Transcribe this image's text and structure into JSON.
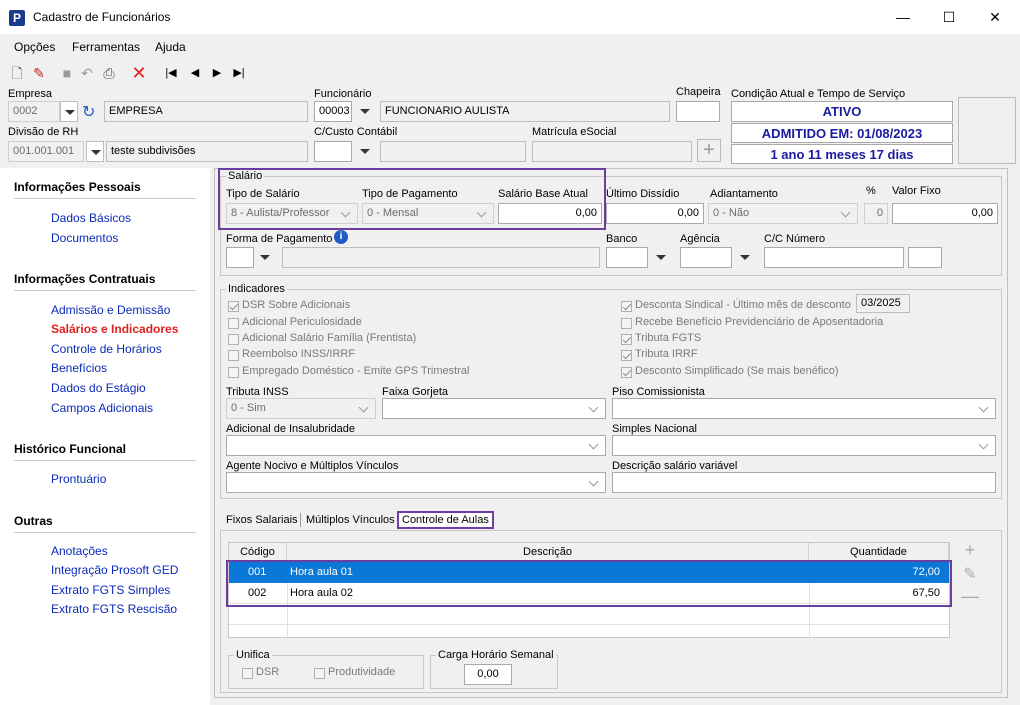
{
  "window": {
    "title": "Cadastro de Funcionários",
    "minimize": "—",
    "maximize": "☐",
    "close": "✕"
  },
  "menu": [
    "Opções",
    "Ferramentas",
    "Ajuda"
  ],
  "header": {
    "empresa_label": "Empresa",
    "empresa_code": "0002",
    "empresa_name": "EMPRESA",
    "funcionario_label": "Funcionário",
    "funcionario_code": "00003",
    "funcionario_name": "FUNCIONARIO AULISTA",
    "chapeira_label": "Chapeira",
    "condicao_label": "Condição Atual e Tempo de Serviço",
    "divisao_label": "Divisão de RH",
    "divisao_code": "001.001.001",
    "divisao_name": "teste subdivisões",
    "ccusto_label": "C/Custo Contábil",
    "matricula_label": "Matrícula eSocial",
    "status": "ATIVO",
    "admitido": "ADMITIDO EM: 01/08/2023",
    "tempo": "1 ano 11 meses 17 dias"
  },
  "sidebar": {
    "sections": [
      {
        "title": "Informações Pessoais",
        "items": [
          "Dados Básicos",
          "Documentos"
        ]
      },
      {
        "title": "Informações Contratuais",
        "items": [
          "Admissão e Demissão",
          "Salários e Indicadores",
          "Controle de Horários",
          "Benefícios",
          "Dados do Estágio",
          "Campos Adicionais"
        ]
      },
      {
        "title": "Histórico Funcional",
        "items": [
          "Prontuário"
        ]
      },
      {
        "title": "Outras",
        "items": [
          "Anotações",
          "Integração Prosoft GED",
          "Extrato FGTS Simples",
          "Extrato FGTS Rescisão"
        ]
      }
    ]
  },
  "salario": {
    "group_title": "Salário",
    "tipo_salario_label": "Tipo de Salário",
    "tipo_salario": "8 - Aulista/Professor",
    "tipo_pagamento_label": "Tipo de Pagamento",
    "tipo_pagamento": "0 - Mensal",
    "base_label": "Salário Base Atual",
    "base": "0,00",
    "ultimo_dissidio_label": "Último Dissídio",
    "ultimo_dissidio": "0,00",
    "adiantamento_label": "Adiantamento",
    "adiantamento": "0 - Não",
    "pct_label": "%",
    "pct": "0",
    "valor_fixo_label": "Valor Fixo",
    "valor_fixo": "0,00",
    "forma_label": "Forma de Pagamento",
    "banco_label": "Banco",
    "agencia_label": "Agência",
    "cc_label": "C/C Número"
  },
  "indicadores": {
    "title": "Indicadores",
    "left": [
      {
        "label": "DSR Sobre Adicionais",
        "checked": true
      },
      {
        "label": "Adicional Periculosidade",
        "checked": false
      },
      {
        "label": "Adicional Salário Família (Frentista)",
        "checked": false
      },
      {
        "label": "Reembolso INSS/IRRF",
        "checked": false
      },
      {
        "label": "Empregado Doméstico - Emite GPS Trimestral",
        "checked": false
      }
    ],
    "right": [
      {
        "label": "Desconta Sindical - Último mês de desconto",
        "checked": true
      },
      {
        "label": "Recebe Benefício Previdenciário de Aposentadoria",
        "checked": false
      },
      {
        "label": "Tributa FGTS",
        "checked": true
      },
      {
        "label": "Tributa IRRF",
        "checked": true
      },
      {
        "label": "Desconto Simplificado (Se mais benéfico)",
        "checked": true
      }
    ],
    "ultimo_mes": "03/2025",
    "tributa_inss_label": "Tributa INSS",
    "tributa_inss": "0 - Sim",
    "faixa_gorjeta_label": "Faixa Gorjeta",
    "piso_label": "Piso Comissionista",
    "insalubridade_label": "Adicional de Insalubridade",
    "simples_label": "Simples Nacional",
    "agente_label": "Agente Nocivo e  Múltiplos Vínculos",
    "descricao_var_label": "Descrição salário variável"
  },
  "tabs": [
    "Fixos Salariais",
    "Múltiplos Vínculos",
    "Controle de Aulas"
  ],
  "grid": {
    "headers": [
      "Código",
      "Descrição",
      "Quantidade"
    ],
    "rows": [
      {
        "codigo": "001",
        "descricao": "Hora aula 01",
        "quantidade": "72,00"
      },
      {
        "codigo": "002",
        "descricao": "Hora aula 02",
        "quantidade": "67,50"
      }
    ]
  },
  "unifica": {
    "title": "Unifica",
    "dsr": "DSR",
    "produtividade": "Produtividade"
  },
  "carga": {
    "title": "Carga Horário Semanal",
    "value": "0,00"
  }
}
